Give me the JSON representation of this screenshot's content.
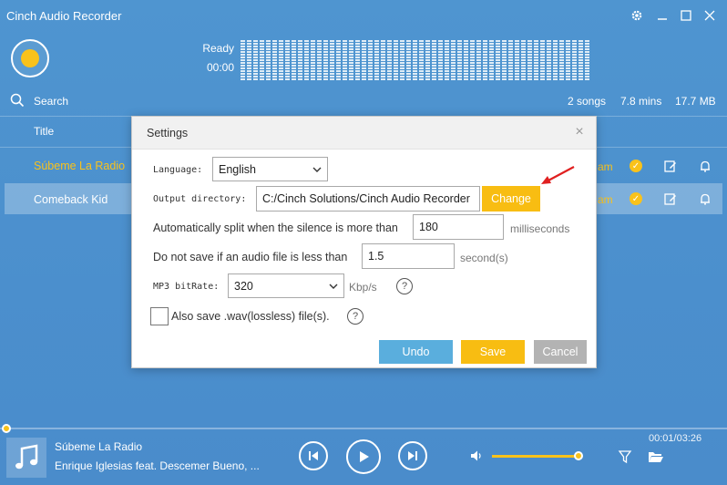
{
  "app": {
    "title": "Cinch Audio Recorder",
    "window_controls": [
      "gear-icon",
      "minimize-icon",
      "maximize-icon",
      "close-icon"
    ]
  },
  "recorder": {
    "status": "Ready",
    "time": "00:00"
  },
  "search": {
    "label": "Search"
  },
  "stats": {
    "songs": "2 songs",
    "duration": "7.8 mins",
    "size": "17.7 MB"
  },
  "list": {
    "column_title": "Title",
    "rows": [
      {
        "title": "Súbeme La Radio",
        "tail": "am",
        "highlight": true
      },
      {
        "title": "Comeback Kid",
        "tail": "am",
        "selected": true
      }
    ]
  },
  "dialog": {
    "title": "Settings",
    "language_label": "Language:",
    "language_value": "English",
    "output_label": "Output directory:",
    "output_value": "C:/Cinch Solutions/Cinch Audio Recorder",
    "change_button": "Change",
    "split_label": "Automatically split when the silence is more than",
    "split_value": "180",
    "split_unit": "milliseconds",
    "minlen_label": "Do not save if an audio file is less than",
    "minlen_value": "1.5",
    "minlen_unit": "second(s)",
    "bitrate_label": "MP3 bitRate:",
    "bitrate_value": "320",
    "bitrate_unit": "Kbp/s",
    "wav_label": "Also save .wav(lossless) file(s).",
    "undo_button": "Undo",
    "save_button": "Save",
    "cancel_button": "Cancel",
    "help_glyph": "?"
  },
  "player": {
    "track_title": "Súbeme La Radio",
    "track_artist": "Enrique Iglesias feat. Descemer Bueno, ...",
    "time": "00:01/03:26",
    "progress": 0.01,
    "volume": 0.95
  },
  "colors": {
    "accent": "#f8bd12",
    "background": "#4f95d0",
    "undo": "#5aaedd",
    "cancel": "#b3b3b3",
    "arrow": "#e02020"
  }
}
